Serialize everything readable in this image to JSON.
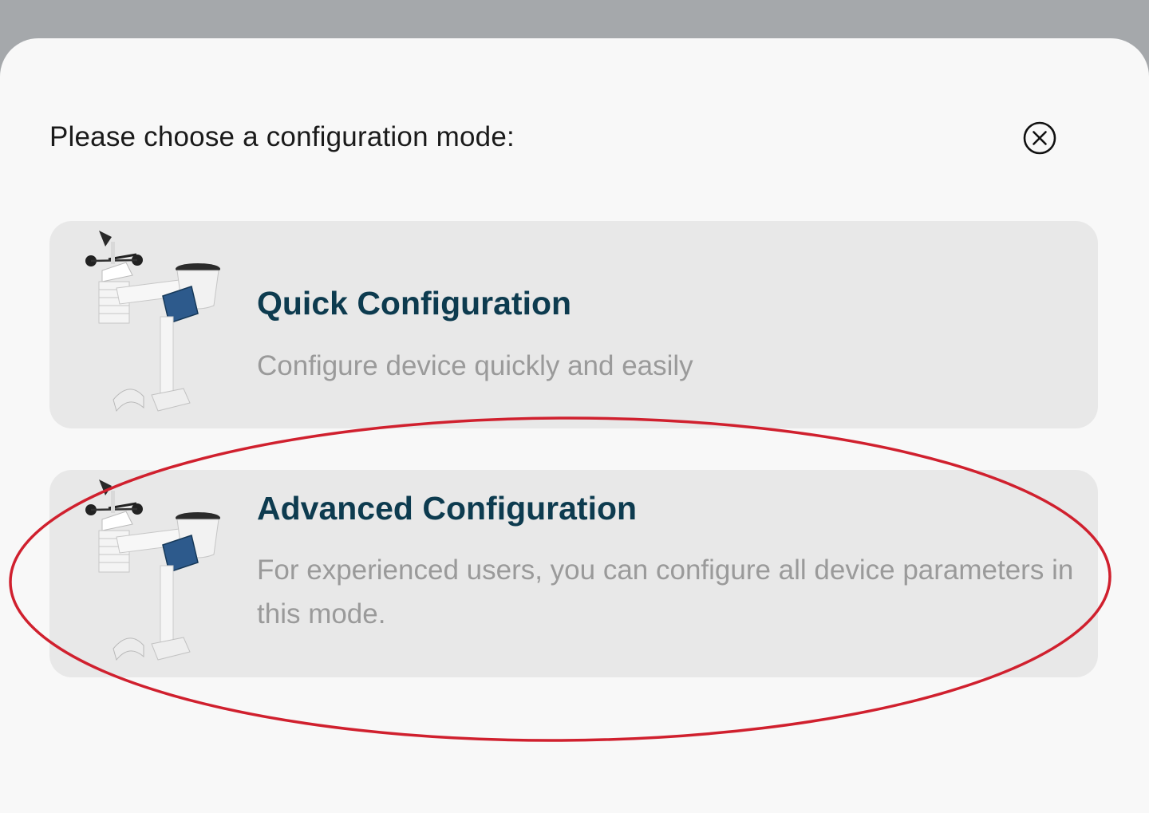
{
  "dialog": {
    "prompt": "Please choose a configuration mode:",
    "close_icon": "close-circle-icon"
  },
  "options": [
    {
      "title": "Quick Configuration",
      "description": "Configure device quickly and easily",
      "image": "weather-station-image"
    },
    {
      "title": "Advanced Configuration",
      "description": "For experienced users, you can configure all device parameters in this mode.",
      "image": "weather-station-image"
    }
  ],
  "colors": {
    "backdrop": "#a5a8ab",
    "sheet": "#f8f8f8",
    "card": "#e8e8e8",
    "title": "#0d3b4f",
    "description": "#9a9a9a",
    "annotation_ellipse": "#d0202e"
  }
}
